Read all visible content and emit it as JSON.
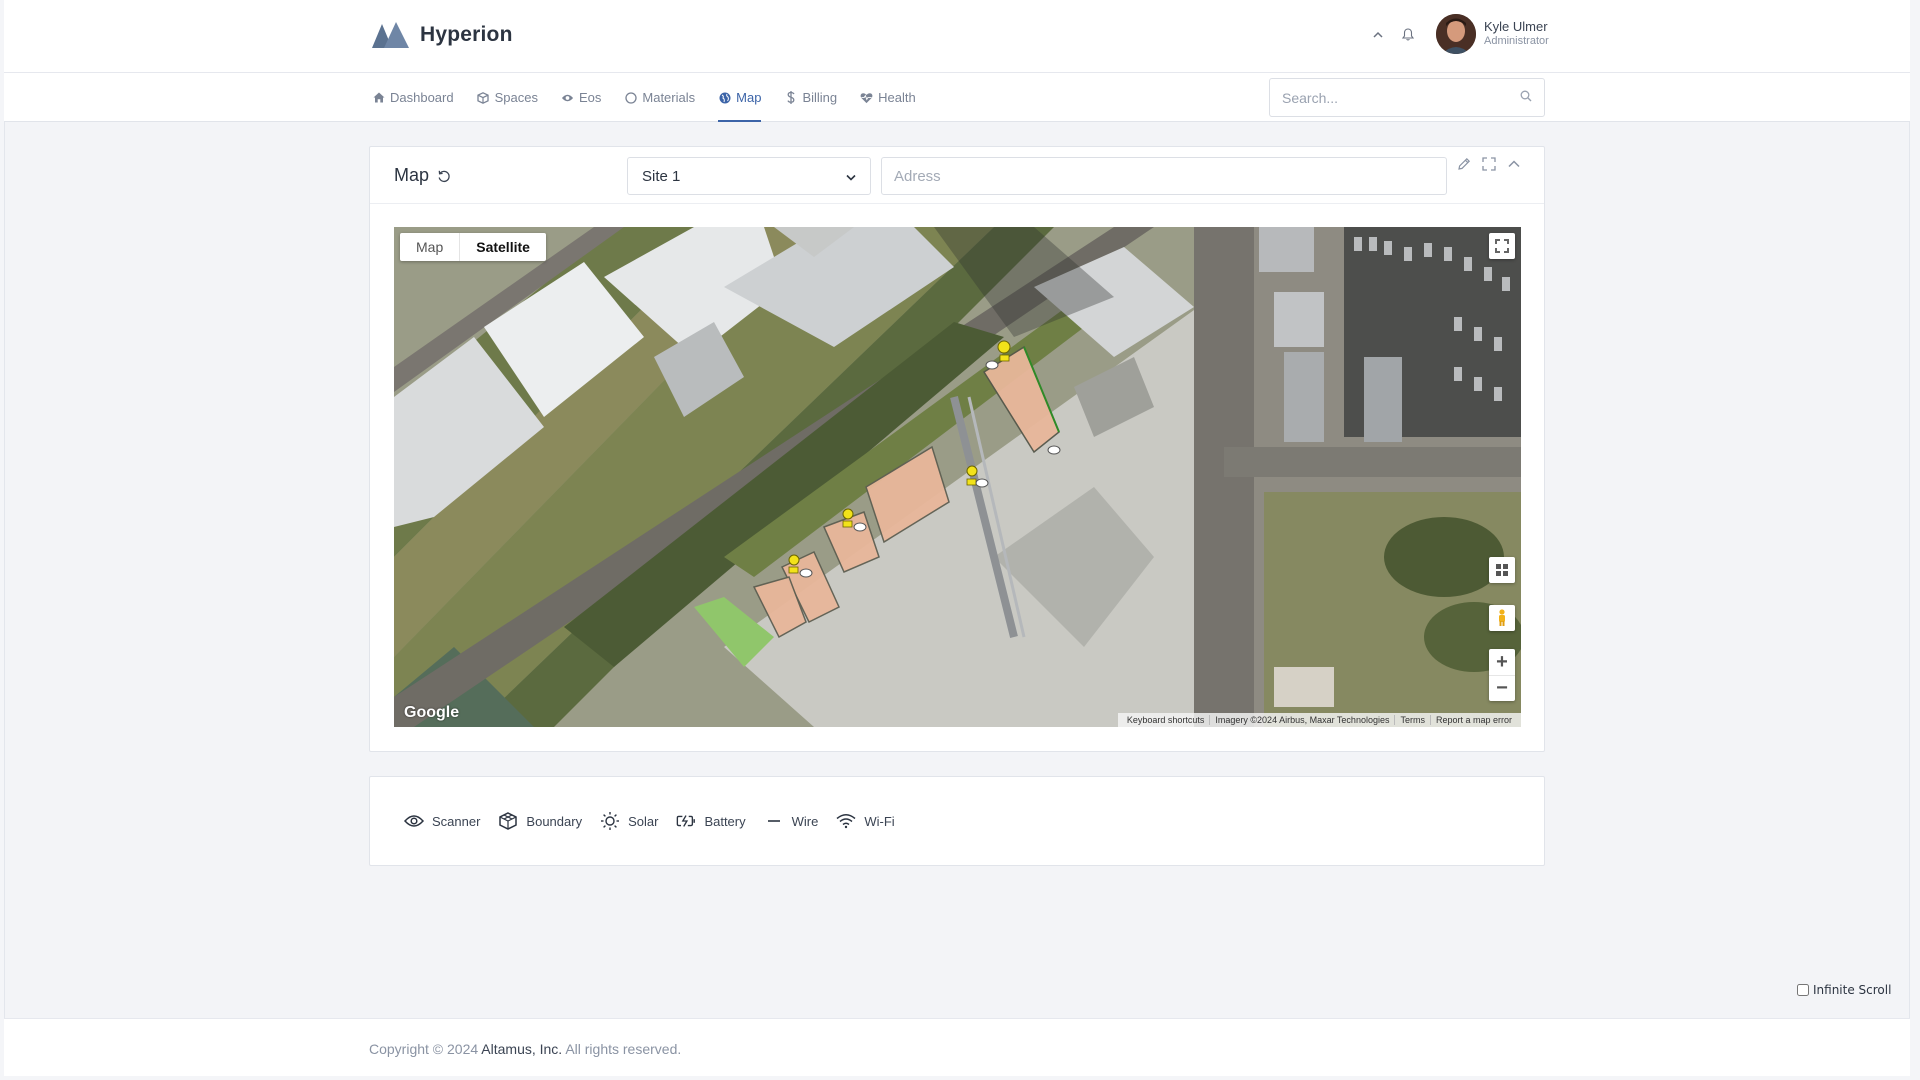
{
  "brand": {
    "name": "Hyperion"
  },
  "user": {
    "name": "Kyle Ulmer",
    "role": "Administrator"
  },
  "nav": {
    "items": [
      {
        "label": "Dashboard",
        "icon": "home-icon"
      },
      {
        "label": "Spaces",
        "icon": "cube-icon"
      },
      {
        "label": "Eos",
        "icon": "eye-icon"
      },
      {
        "label": "Materials",
        "icon": "circle-icon"
      },
      {
        "label": "Map",
        "icon": "globe-icon",
        "active": true
      },
      {
        "label": "Billing",
        "icon": "dollar-icon"
      },
      {
        "label": "Health",
        "icon": "heartbeat-icon"
      }
    ],
    "search_placeholder": "Search..."
  },
  "map_card": {
    "title": "Map",
    "site_selected": "Site 1",
    "address_placeholder": "Adress",
    "map_type": {
      "map_label": "Map",
      "satellite_label": "Satellite",
      "selected": "Satellite"
    },
    "google_label": "Google",
    "attribution": {
      "shortcuts": "Keyboard shortcuts",
      "imagery": "Imagery ©2024 Airbus, Maxar Technologies",
      "terms": "Terms",
      "report": "Report a map error"
    }
  },
  "legend": {
    "items": [
      {
        "label": "Scanner",
        "icon": "eye-icon"
      },
      {
        "label": "Boundary",
        "icon": "boundary-cube-icon"
      },
      {
        "label": "Solar",
        "icon": "sun-icon"
      },
      {
        "label": "Battery",
        "icon": "battery-charging-icon"
      },
      {
        "label": "Wire",
        "icon": "wire-line-icon"
      },
      {
        "label": "Wi-Fi",
        "icon": "wifi-icon"
      }
    ]
  },
  "infinite_scroll": {
    "label": "Infinite Scroll",
    "checked": false
  },
  "footer": {
    "prefix": "Copyright © 2024 ",
    "company": "Altamus, Inc.",
    "suffix": " All rights reserved."
  },
  "colors": {
    "accent": "#3c64a8",
    "boundary_fill": "#e8b79a",
    "solar_marker": "#f2e21a"
  }
}
